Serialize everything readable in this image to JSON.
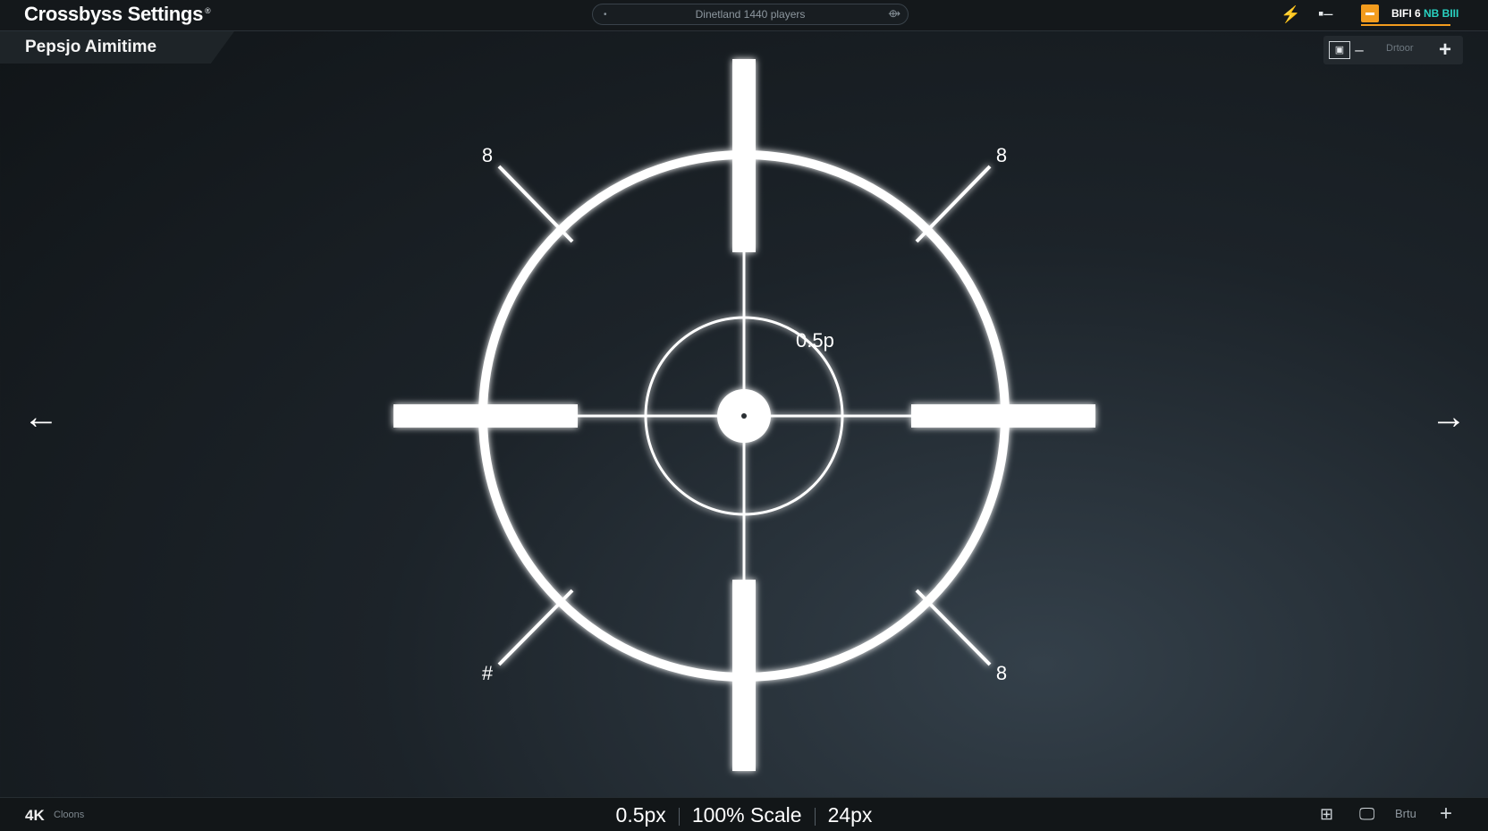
{
  "app": {
    "title": "Crossbyss Settings",
    "title_mark": "®"
  },
  "search": {
    "placeholder": "Dinetland 1440 players"
  },
  "top_right": {
    "badge_text": "BIFI 6",
    "badge_suffix": "NB BIII",
    "accent": "#f39c1e",
    "accent2": "#29d3c2"
  },
  "subtab": {
    "label": "Pepsjo Aimitime"
  },
  "toolbar": {
    "zoom_label": "Drtoor",
    "minus_icon": "minus-icon",
    "plus_icon": "plus-icon"
  },
  "crosshair": {
    "center_label": "0.5p",
    "corner_labels": {
      "top_left": "8",
      "top_right": "8",
      "bottom_left": "#",
      "bottom_right": "8"
    }
  },
  "bottom": {
    "left_label": "4K",
    "left_sub": "Cloons",
    "stat_thickness": "0.5px",
    "stat_scale": "100% Scale",
    "stat_size": "24px",
    "right_label": "Brtu"
  },
  "nav": {
    "prev_icon": "arrow-left-icon",
    "next_icon": "arrow-right-icon"
  }
}
